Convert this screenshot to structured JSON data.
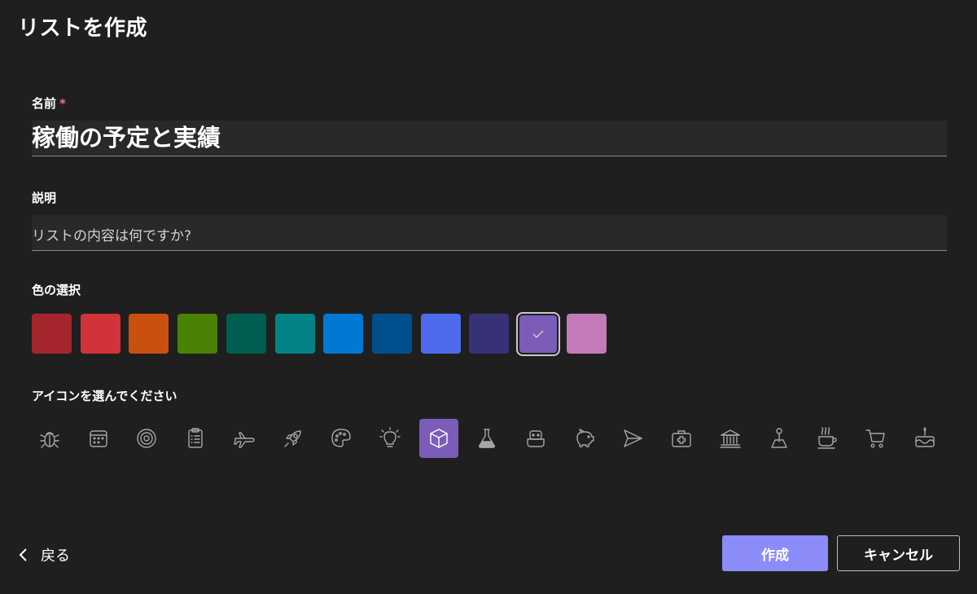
{
  "dialog": {
    "title": "リストを作成"
  },
  "name": {
    "label": "名前",
    "required_mark": "*",
    "value": "稼働の予定と実績"
  },
  "description": {
    "label": "説明",
    "placeholder": "リストの内容は何ですか?"
  },
  "color": {
    "label": "色の選択",
    "selected_index": 10,
    "swatches": [
      "#a4262c",
      "#d13438",
      "#ca5010",
      "#498205",
      "#005e50",
      "#038387",
      "#0078d4",
      "#004e8c",
      "#4f6bed",
      "#373277",
      "#7b5cb8",
      "#c27ab8"
    ]
  },
  "icon": {
    "label": "アイコンを選んでください",
    "selected_index": 8,
    "items": [
      "bug-icon",
      "calendar-icon",
      "target-icon",
      "clipboard-icon",
      "airplane-icon",
      "rocket-icon",
      "palette-icon",
      "lightbulb-icon",
      "cube-icon",
      "flask-icon",
      "robot-icon",
      "piggy-bank-icon",
      "send-icon",
      "first-aid-kit-icon",
      "bank-icon",
      "joystick-icon",
      "coffee-icon",
      "cart-icon",
      "cake-icon"
    ]
  },
  "footer": {
    "back_label": "戻る",
    "create_label": "作成",
    "cancel_label": "キャンセル"
  },
  "colors": {
    "background": "#1f1f1f",
    "field": "#292929",
    "primary_button": "#8b8cf7",
    "selected_icon_bg": "#7b5cb8"
  }
}
